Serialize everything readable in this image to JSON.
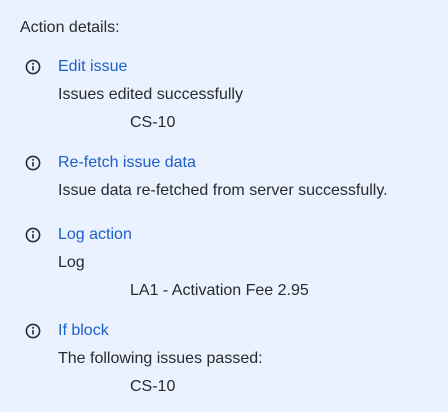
{
  "panel": {
    "heading": "Action details:"
  },
  "actions": [
    {
      "icon": "info-icon",
      "title": "Edit issue",
      "description": "Issues edited successfully",
      "item": "CS-10"
    },
    {
      "icon": "info-icon",
      "title": "Re-fetch issue data",
      "description": "Issue data re-fetched from server successfully."
    },
    {
      "icon": "info-icon",
      "title": "Log action",
      "description": "Log",
      "item": "LA1 - Activation Fee 2.95"
    },
    {
      "icon": "info-icon",
      "title": "If block",
      "description": "The following issues passed:",
      "item": "CS-10"
    }
  ],
  "colors": {
    "background": "#e9f2fe",
    "link": "#1d5fc7",
    "text": "#292a2e"
  }
}
